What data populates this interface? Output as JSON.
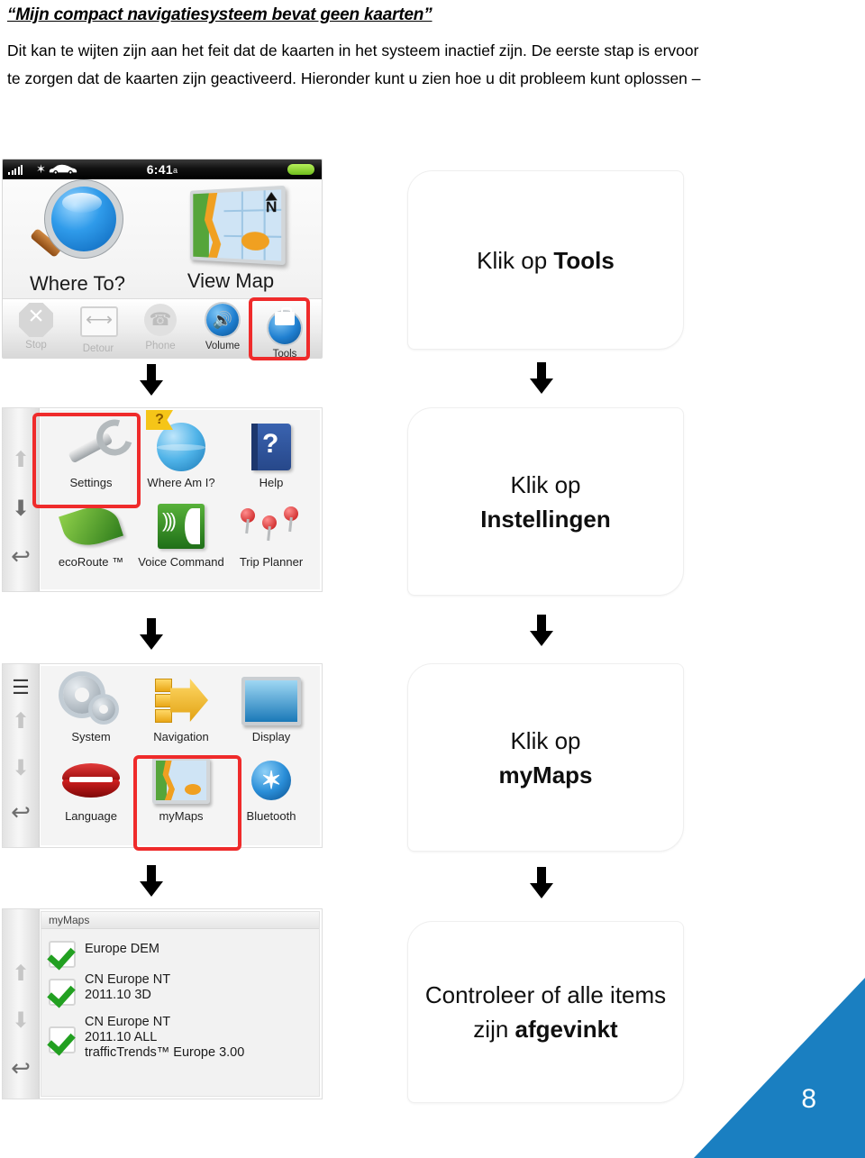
{
  "document": {
    "title": "“Mijn compact navigatiesysteem bevat geen kaarten”",
    "paragraph": "Dit kan te wijten zijn aan het feit dat de kaarten in het systeem inactief zijn. De eerste stap is ervoor te zorgen dat de kaarten zijn geactiveerd. Hieronder kunt u zien hoe u dit probleem kunt oplossen –",
    "page_number": "8",
    "accent_color": "#1a7fc1",
    "highlight_color": "#ef2b2b"
  },
  "screens": {
    "home": {
      "status_bar": {
        "time": "6:41",
        "ampm": "a",
        "signal_icon": "signal-bars-icon",
        "bluetooth_icon": "bluetooth-icon",
        "vehicle_icon": "car-icon",
        "battery_icon": "battery-icon"
      },
      "primary_buttons": [
        {
          "label": "Where To?",
          "icon": "magnifier-icon"
        },
        {
          "label": "View Map",
          "icon": "map-tile-icon"
        }
      ],
      "tray": [
        {
          "label": "Stop",
          "icon": "stop-octagon-icon",
          "enabled": false
        },
        {
          "label": "Detour",
          "icon": "detour-arrows-icon",
          "enabled": false
        },
        {
          "label": "Phone",
          "icon": "phone-handset-icon",
          "enabled": false
        },
        {
          "label": "Volume",
          "icon": "speaker-icon",
          "enabled": true
        },
        {
          "label": "Tools",
          "icon": "toolbox-icon",
          "enabled": true
        }
      ],
      "highlighted_item": "Tools"
    },
    "tools_menu": {
      "sidebar_icons": [
        "scroll-up-arrow-icon",
        "scroll-down-arrow-icon",
        "back-arrow-icon"
      ],
      "items": [
        {
          "label": "Settings",
          "icon": "wrench-icon"
        },
        {
          "label": "Where Am I?",
          "icon": "globe-flag-icon"
        },
        {
          "label": "Help",
          "icon": "help-book-icon"
        },
        {
          "label": "ecoRoute ™",
          "icon": "leaf-icon"
        },
        {
          "label": "Voice Command",
          "icon": "voice-command-icon"
        },
        {
          "label": "Trip Planner",
          "icon": "map-pins-icon"
        }
      ],
      "highlighted_item": "Settings"
    },
    "settings_menu": {
      "sidebar_icons": [
        "menu-icon",
        "scroll-up-arrow-icon",
        "scroll-down-arrow-icon",
        "back-arrow-icon"
      ],
      "items": [
        {
          "label": "System",
          "icon": "gears-icon"
        },
        {
          "label": "Navigation",
          "icon": "navigation-arrow-icon"
        },
        {
          "label": "Display",
          "icon": "display-screen-icon"
        },
        {
          "label": "Language",
          "icon": "lips-icon"
        },
        {
          "label": "myMaps",
          "icon": "map-tile-icon"
        },
        {
          "label": "Bluetooth",
          "icon": "bluetooth-icon"
        }
      ],
      "highlighted_item": "myMaps"
    },
    "mymaps_list": {
      "panel_title": "myMaps",
      "sidebar_icons": [
        "scroll-up-arrow-icon",
        "scroll-down-arrow-icon",
        "back-arrow-icon"
      ],
      "items": [
        {
          "lines": [
            "Europe DEM"
          ],
          "checked": true
        },
        {
          "lines": [
            "CN Europe NT",
            "2011.10 3D"
          ],
          "checked": true
        },
        {
          "lines": [
            "CN Europe NT",
            "2011.10 ALL",
            "trafficTrends™ Europe 3.00"
          ],
          "checked": true
        }
      ]
    }
  },
  "callouts": [
    {
      "plain": "Klik op ",
      "bold": "Tools",
      "tail": ""
    },
    {
      "plain": "Klik op",
      "bold": "Instellingen",
      "tail": ""
    },
    {
      "plain": "Klik op",
      "bold": "myMaps",
      "tail": ""
    },
    {
      "plain": "Controleer of alle items zijn ",
      "bold": "afgevinkt",
      "tail": ""
    }
  ],
  "arrows": {
    "icon": "down-arrow-icon",
    "count": 6
  }
}
